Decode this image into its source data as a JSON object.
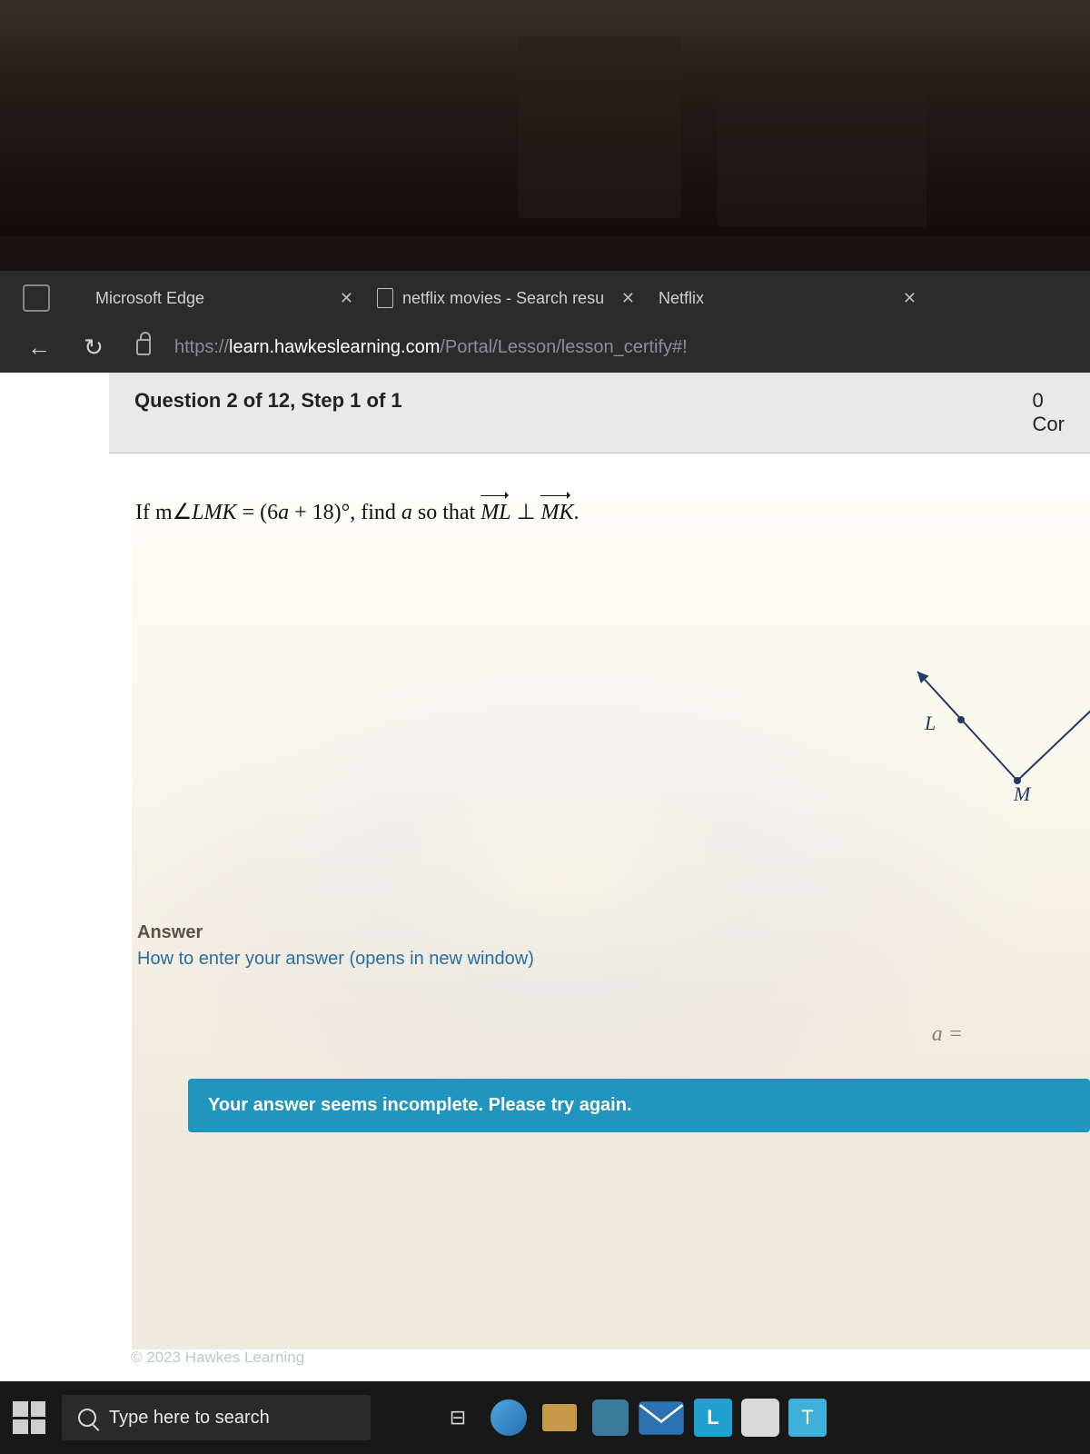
{
  "tabs": [
    {
      "title": "Microsoft Edge"
    },
    {
      "title": "netflix movies - Search resu"
    },
    {
      "title": "Netflix"
    }
  ],
  "url": {
    "scheme": "https://",
    "host": "learn.hawkeslearning.com",
    "path": "/Portal/Lesson/lesson_certify#!"
  },
  "question": {
    "header": "Question 2 of 12, Step 1 of 1",
    "status_partial": "Cor",
    "status_count": "0",
    "prompt_prefix": "If m",
    "angle_symbol": "∠",
    "angle_name": "LMK",
    "equals": " = ",
    "expr_open": "(6",
    "expr_var": "a",
    "expr_rest": " + 18)",
    "degree": "°",
    "prompt_mid": ", find ",
    "find_var": "a",
    "prompt_so": " so that ",
    "ray1": "ML",
    "perp": " ⊥ ",
    "ray2": "MK",
    "period": "."
  },
  "diagram": {
    "L": "L",
    "M": "M"
  },
  "answer": {
    "title": "Answer",
    "help": "How to enter your answer (opens in new window)",
    "a_label": "a =",
    "error": "Your answer seems incomplete.  Please try again."
  },
  "copyright": "© 2023 Hawkes Learning",
  "taskbar": {
    "search_placeholder": "Type here to search",
    "L": "L",
    "T": "T"
  }
}
